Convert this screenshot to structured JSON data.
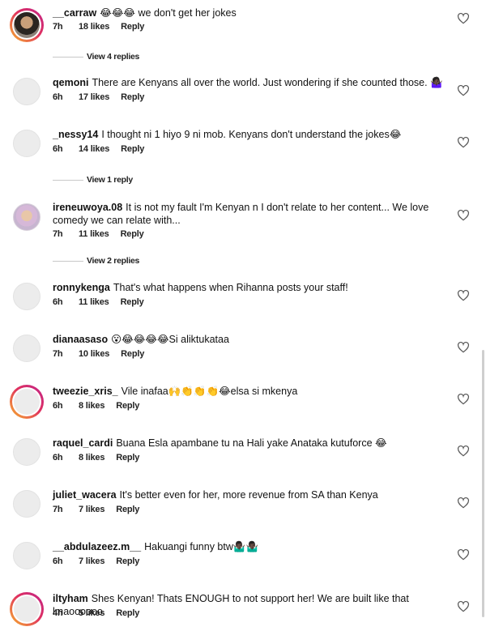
{
  "comments": [
    {
      "user": "__carraw",
      "text": "😂😂😂 we don't get her jokes",
      "time": "7h",
      "likes": "18 likes",
      "reply": "Reply",
      "avatar": "ring-photo",
      "view_replies": "View 4 replies"
    },
    {
      "user": "qemoni",
      "text": "There are Kenyans all over the world. Just wondering if she counted those. 🤷🏿‍♀️",
      "time": "6h",
      "likes": "17 likes",
      "reply": "Reply",
      "avatar": "plain"
    },
    {
      "user": "_nessy14",
      "text": "I thought ni 1 hiyo 9 ni mob. Kenyans don't understand the jokes😂",
      "time": "6h",
      "likes": "14 likes",
      "reply": "Reply",
      "avatar": "plain",
      "view_replies": "View 1 reply"
    },
    {
      "user": "ireneuwoya.08",
      "text": "It is not my fault I'm Kenyan n I don't relate to her content... We love comedy we can relate with...",
      "time": "7h",
      "likes": "11 likes",
      "reply": "Reply",
      "avatar": "photo",
      "view_replies": "View 2 replies"
    },
    {
      "user": "ronnykenga",
      "text": "That's what happens when Rihanna posts your staff!",
      "time": "6h",
      "likes": "11 likes",
      "reply": "Reply",
      "avatar": "plain"
    },
    {
      "user": "dianaasaso",
      "text": "😮😂😂😂😂Si aliktukataa",
      "time": "7h",
      "likes": "10 likes",
      "reply": "Reply",
      "avatar": "plain"
    },
    {
      "user": "tweezie_xris_",
      "text": "Vile inafaa🙌👏👏👏😂elsa si mkenya",
      "time": "6h",
      "likes": "8 likes",
      "reply": "Reply",
      "avatar": "ring"
    },
    {
      "user": "raquel_cardi",
      "text": "Buana Esla apambane tu na Hali yake Anataka kutuforce 😂",
      "time": "6h",
      "likes": "8 likes",
      "reply": "Reply",
      "avatar": "plain"
    },
    {
      "user": "juliet_wacera",
      "text": "It's better even for her, more revenue from SA than Kenya",
      "time": "7h",
      "likes": "7 likes",
      "reply": "Reply",
      "avatar": "plain"
    },
    {
      "user": "__abdulazeez.m__",
      "text": "Hakuangi funny btw🤷🏿‍♂️🤷🏿‍♂️",
      "time": "6h",
      "likes": "7 likes",
      "reply": "Reply",
      "avatar": "plain"
    },
    {
      "user": "iltyham",
      "text": "Shes Kenyan! Thats ENOUGH to not support her! We are built like that lmaoooooo",
      "time": "4h",
      "likes": "5 likes",
      "reply": "Reply",
      "avatar": "ring"
    }
  ]
}
